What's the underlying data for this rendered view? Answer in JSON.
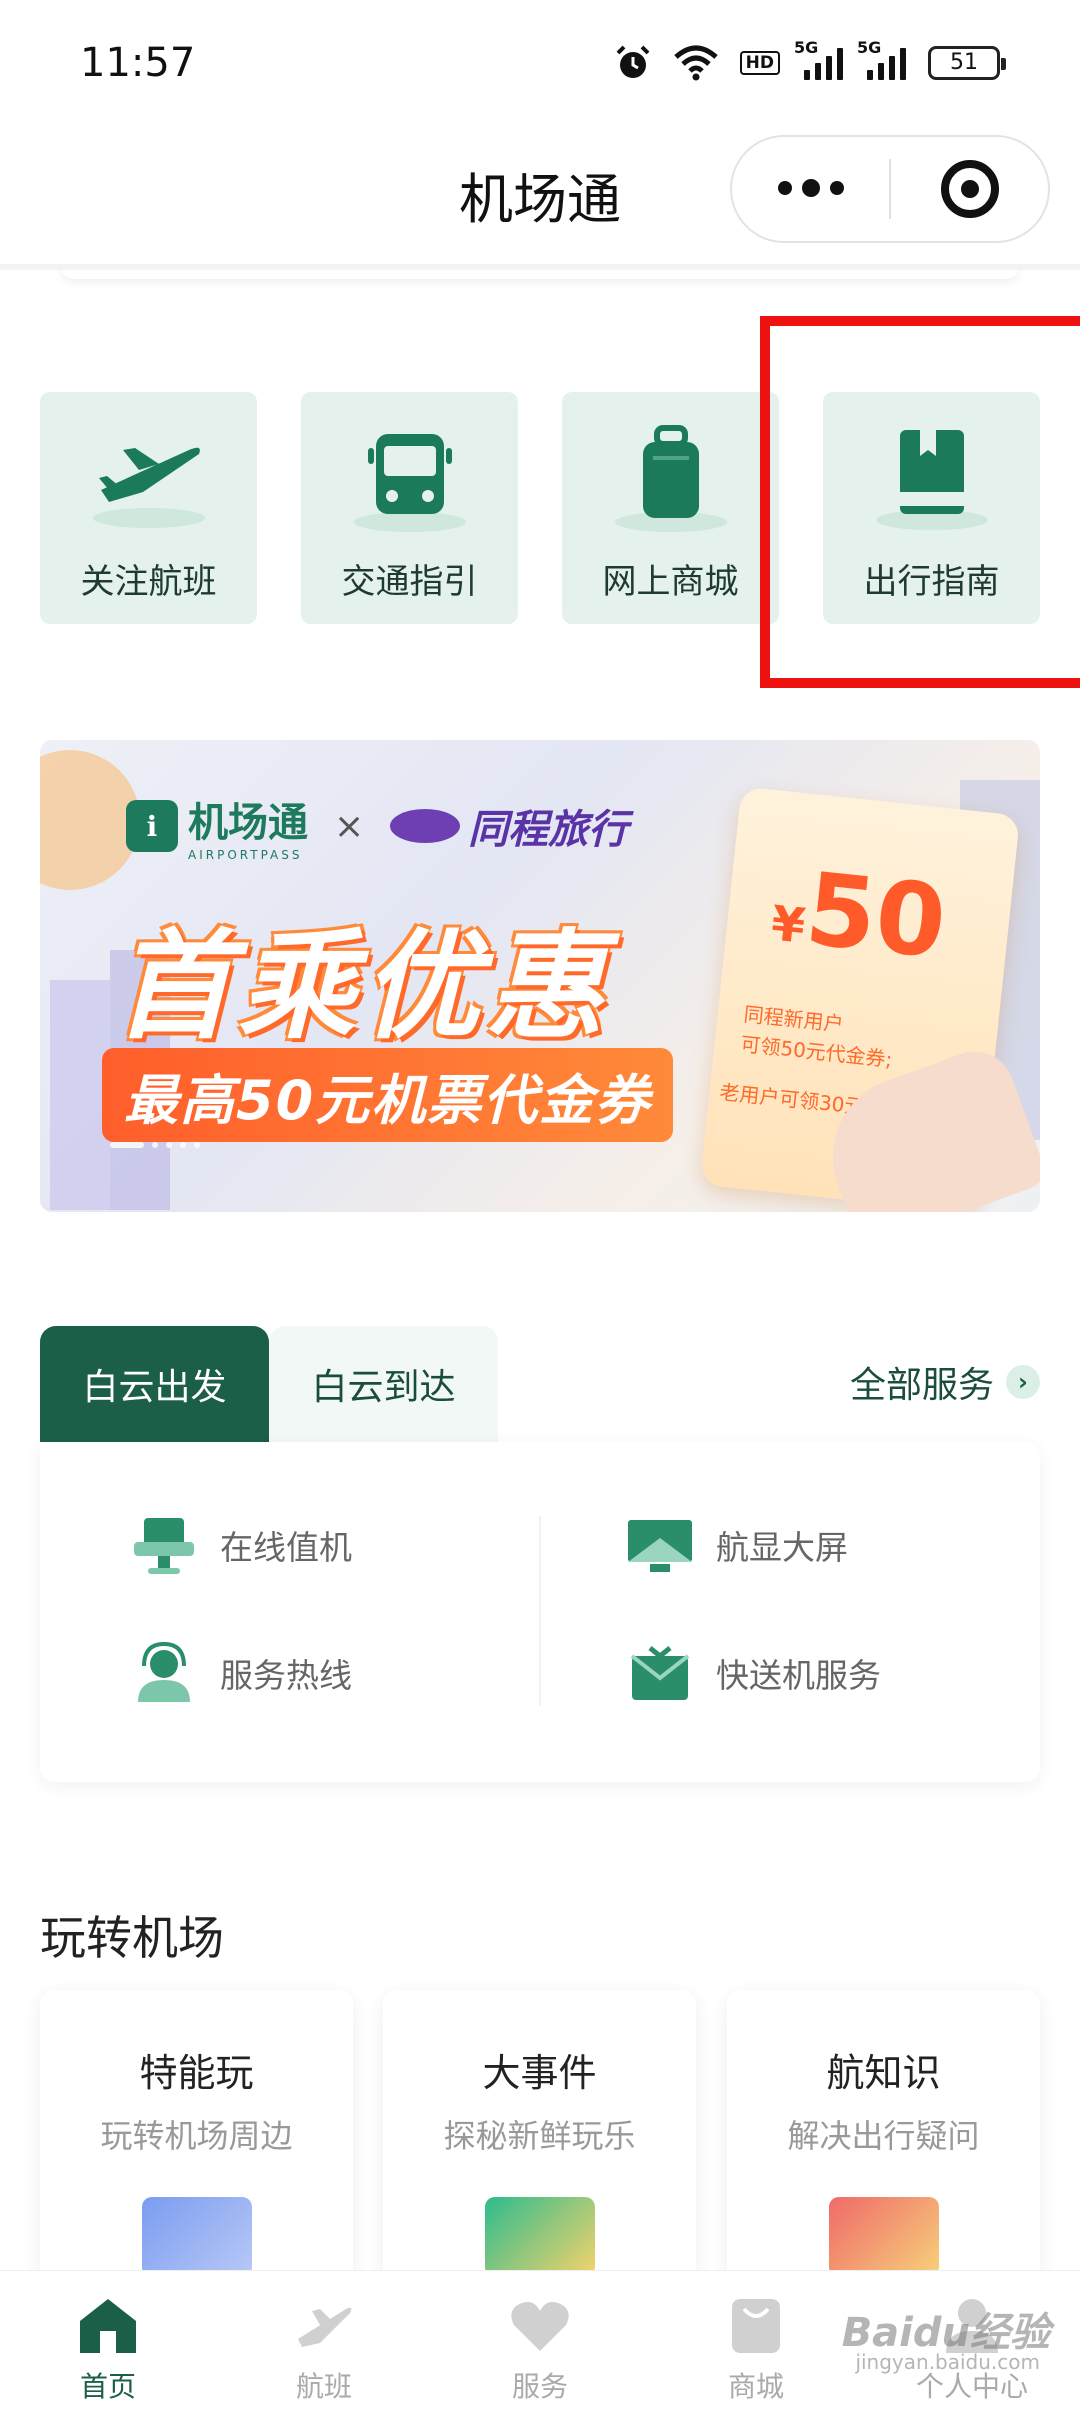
{
  "status_bar": {
    "time": "11:57",
    "hd_label": "HD",
    "signal_tag": "5G",
    "battery": "51"
  },
  "nav": {
    "title": "机场通"
  },
  "quick_actions": [
    {
      "label": "关注航班",
      "icon": "plane-icon"
    },
    {
      "label": "交通指引",
      "icon": "bus-icon"
    },
    {
      "label": "网上商城",
      "icon": "luggage-icon"
    },
    {
      "label": "出行指南",
      "icon": "book-icon"
    }
  ],
  "banner": {
    "brand": "机场通",
    "brand_sub": "AIRPORTPASS",
    "x": "×",
    "partner": "同程旅行",
    "headline": "首乘优惠",
    "subline": "最高50元机票代金券",
    "coupon_currency": "¥",
    "coupon_amount": "50",
    "coupon_line1": "同程新用户",
    "coupon_line2": "可领50元代金券;",
    "coupon_line3": "老用户可领30元代金券"
  },
  "services": {
    "tab_departure": "白云出发",
    "tab_arrival": "白云到达",
    "all_services": "全部服务",
    "items": [
      {
        "label": "在线值机",
        "icon": "checkin-kiosk-icon"
      },
      {
        "label": "航显大屏",
        "icon": "flight-display-icon"
      },
      {
        "label": "服务热线",
        "icon": "hotline-agent-icon"
      },
      {
        "label": "快送机服务",
        "icon": "fast-service-icon"
      }
    ]
  },
  "play": {
    "title": "玩转机场",
    "cards": [
      {
        "title": "特能玩",
        "subtitle": "玩转机场周边"
      },
      {
        "title": "大事件",
        "subtitle": "探秘新鲜玩乐"
      },
      {
        "title": "航知识",
        "subtitle": "解决出行疑问"
      }
    ]
  },
  "tab_bar": [
    {
      "label": "首页",
      "icon": "home-icon",
      "active": true
    },
    {
      "label": "航班",
      "icon": "plane-icon"
    },
    {
      "label": "服务",
      "icon": "heart-icon"
    },
    {
      "label": "商城",
      "icon": "bag-icon"
    },
    {
      "label": "个人中心",
      "icon": "person-icon"
    }
  ],
  "watermark": {
    "text": "Baidu经验",
    "sub": "jingyan.baidu.com"
  },
  "colors": {
    "brand_green": "#1b5f48",
    "tile_bg": "#e4f1ec",
    "highlight_red": "#ef1010",
    "coupon_orange": "#ff5a2a"
  }
}
